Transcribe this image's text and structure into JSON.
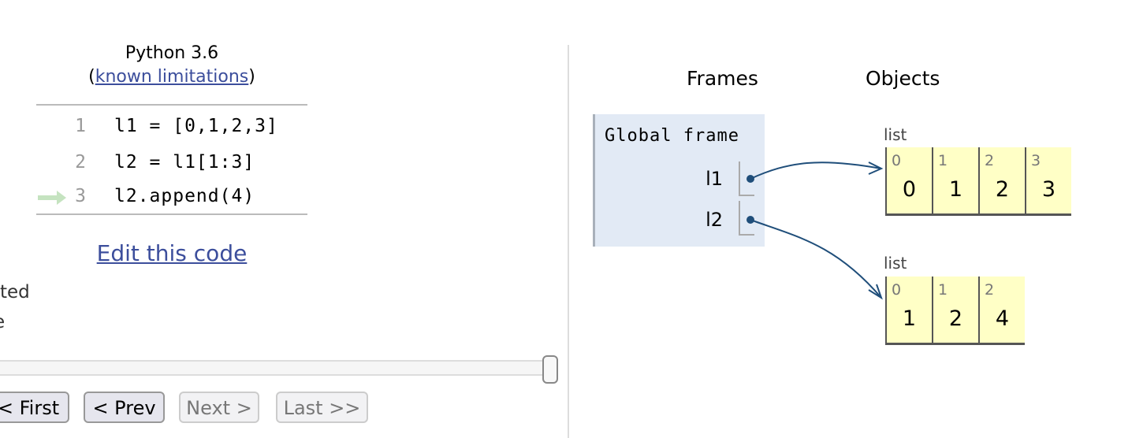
{
  "editor": {
    "language": "Python 3.6",
    "limitations_open": "(",
    "limitations_link": "known limitations",
    "limitations_close": ")",
    "code_lines": [
      {
        "num": "1",
        "text": "l1 = [0,1,2,3]"
      },
      {
        "num": "2",
        "text": "l2 = l1[1:3]"
      },
      {
        "num": "3",
        "text": "l2.append(4)",
        "current": true
      }
    ],
    "edit_link": "Edit this code",
    "legend_fragments": [
      "ted",
      "e"
    ],
    "slider_progress": 1.0,
    "buttons": {
      "first": "< First",
      "prev": "< Prev",
      "next": "Next >",
      "last": "Last >>"
    },
    "arrow_color": "#c5e3c0"
  },
  "viz": {
    "frames_title": "Frames",
    "objects_title": "Objects",
    "frame_name": "Global frame",
    "variables": [
      {
        "name": "l1"
      },
      {
        "name": "l2"
      }
    ],
    "objects": [
      {
        "type": "list",
        "items": [
          {
            "i": "0",
            "v": "0"
          },
          {
            "i": "1",
            "v": "1"
          },
          {
            "i": "2",
            "v": "2"
          },
          {
            "i": "3",
            "v": "3"
          }
        ]
      },
      {
        "type": "list",
        "items": [
          {
            "i": "0",
            "v": "1"
          },
          {
            "i": "1",
            "v": "2"
          },
          {
            "i": "2",
            "v": "4"
          }
        ]
      }
    ],
    "pointer_color": "#1f4e7a",
    "list_color": "#ffffc6"
  }
}
